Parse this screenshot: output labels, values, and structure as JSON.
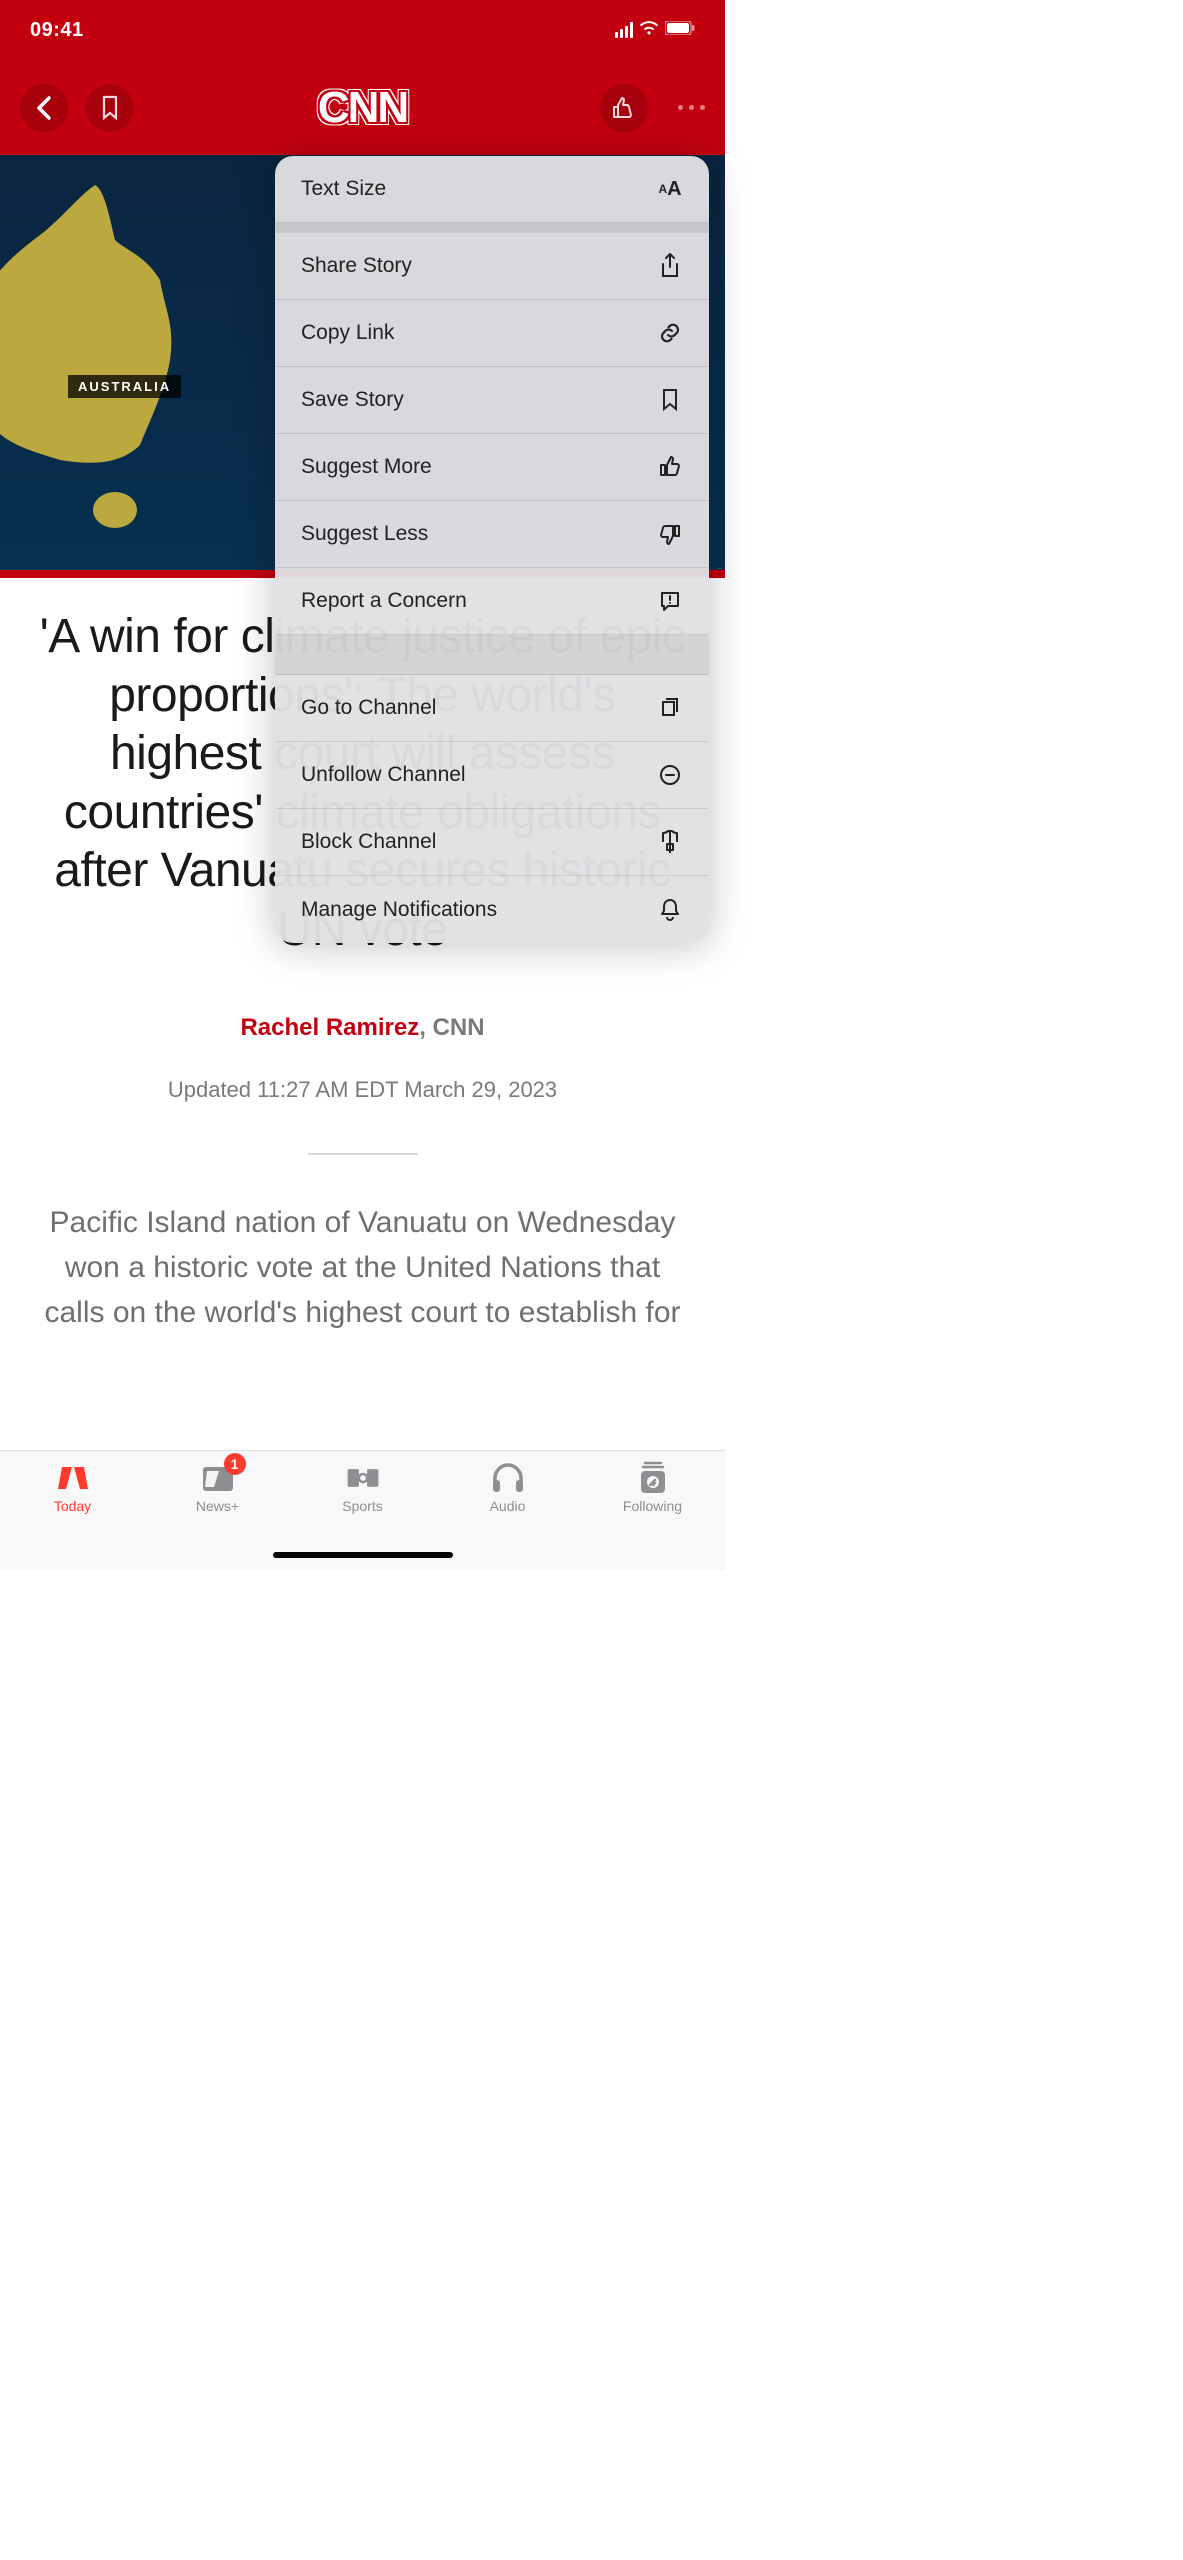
{
  "status": {
    "time": "09:41"
  },
  "brand": "CNN",
  "hero": {
    "map_label": "AUSTRALIA"
  },
  "article": {
    "headline": "'A win for climate justice of epic proportions': The world's highest court will assess countries' climate obligations after Vanuatu secures historic UN vote",
    "author": "Rachel Ramirez",
    "org_sep": ", ",
    "org": "CNN",
    "meta": "Updated 11:27 AM EDT March 29, 2023",
    "body": "Pacific Island nation of Vanuatu on Wednesday won a historic vote at the United Nations that calls on the world's highest court to establish for"
  },
  "menu": {
    "text_size": "Text Size",
    "share": "Share Story",
    "copy": "Copy Link",
    "save": "Save Story",
    "suggest_more": "Suggest More",
    "suggest_less": "Suggest Less",
    "report": "Report a Concern",
    "go_channel": "Go to Channel",
    "unfollow": "Unfollow Channel",
    "block": "Block Channel",
    "manage_notif": "Manage Notifications"
  },
  "tabs": {
    "today": "Today",
    "newsplus": "News+",
    "newsplus_badge": "1",
    "sports": "Sports",
    "audio": "Audio",
    "following": "Following"
  }
}
